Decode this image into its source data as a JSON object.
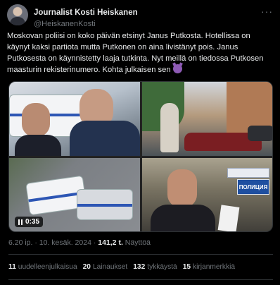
{
  "author": {
    "name": "Journalist Kosti Heiskanen",
    "handle": "@HeiskanenKosti"
  },
  "tweet": {
    "text": "Moskovan poliisi on koko päivän etsinyt Janus Putkosta. Hotellissa on käynyt kaksi partiota mutta Putkonen on aina livistänyt pois. Janus Putkosesta on käynnistetty laaja tutkinta. Nyt meillä on tiedossa Putkosen maasturin rekisterinumero. Kohta julkaisen sen"
  },
  "media": {
    "video_duration": "0:35",
    "sign_text": "ПОЛИЦИЯ"
  },
  "meta": {
    "time_date": "6.20 ip. · 10. kesäk. 2024 · ",
    "views_count": "141,2 t.",
    "views_label": " Näyttöä"
  },
  "stats": [
    {
      "count": "11",
      "label": "uudelleenjulkaisua"
    },
    {
      "count": "20",
      "label": "Lainaukset"
    },
    {
      "count": "132",
      "label": "tykkäystä"
    },
    {
      "count": "15",
      "label": "kirjanmerkkiä"
    }
  ],
  "icons": {
    "more": "more-icon",
    "emoji": "smiling-imp-emoji",
    "pause": "pause-icon"
  },
  "colors": {
    "background": "#000000",
    "text": "#e7e9ea",
    "secondary": "#71767b",
    "border": "#2f3336"
  }
}
